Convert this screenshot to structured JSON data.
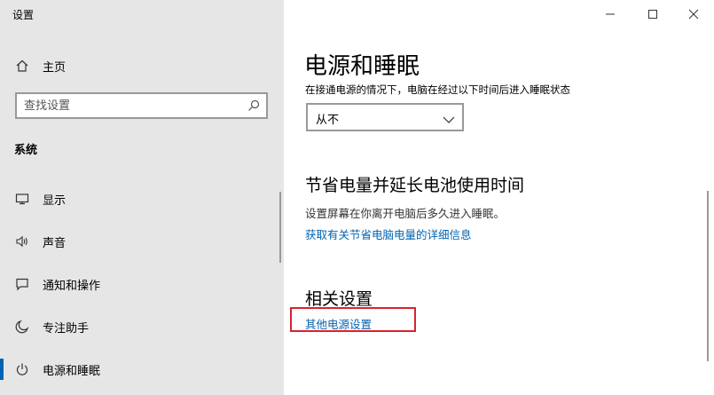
{
  "app": {
    "title": "设置"
  },
  "sidebar": {
    "home_label": "主页",
    "search_placeholder": "查找设置",
    "section_label": "系统",
    "items": [
      {
        "label": "显示",
        "icon": "monitor-icon"
      },
      {
        "label": "声音",
        "icon": "speaker-icon"
      },
      {
        "label": "通知和操作",
        "icon": "notification-icon"
      },
      {
        "label": "专注助手",
        "icon": "moon-icon"
      },
      {
        "label": "电源和睡眠",
        "icon": "power-icon",
        "active": true
      }
    ]
  },
  "main": {
    "title": "电源和睡眠",
    "sleep_description": "在接通电源的情况下，电脑在经过以下时间后进入睡眠状态",
    "sleep_dropdown_value": "从不",
    "battery_section": {
      "heading": "节省电量并延长电池使用时间",
      "text": "设置屏幕在你离开电脑后多久进入睡眠。",
      "link": "获取有关节省电脑电量的详细信息"
    },
    "related_section": {
      "heading": "相关设置",
      "link": "其他电源设置"
    }
  },
  "colors": {
    "accent": "#0063b1",
    "sidebar_bg": "#e6e6e6",
    "highlight": "#d9232e"
  }
}
